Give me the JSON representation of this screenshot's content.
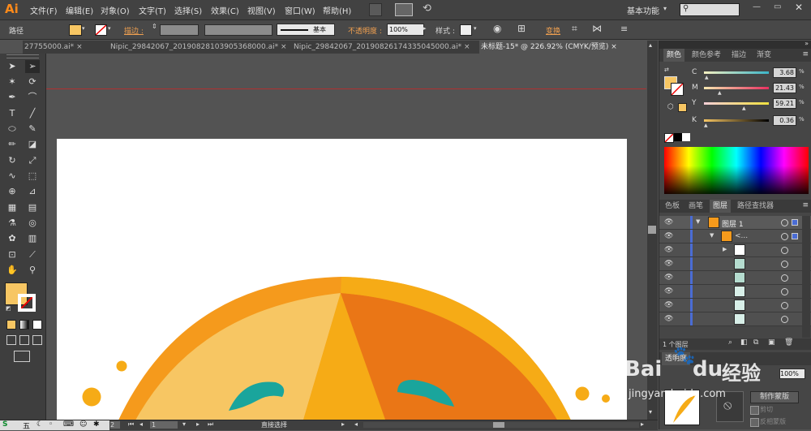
{
  "app": {
    "logo": "Ai",
    "workspace": "基本功能",
    "search_icon": "search-icon"
  },
  "menu": [
    "文件(F)",
    "编辑(E)",
    "对象(O)",
    "文字(T)",
    "选择(S)",
    "效果(C)",
    "视图(V)",
    "窗口(W)",
    "帮助(H)"
  ],
  "control": {
    "selection_label": "路径",
    "stroke_label": "描边 :",
    "stroke_profile": "基本",
    "opacity_label": "不透明度 :",
    "opacity_value": "100%",
    "style_label": "样式 :",
    "transform_label": "变换"
  },
  "tabs": [
    {
      "label": "27755000.ai*",
      "active": false
    },
    {
      "label": "Nipic_29842067_20190828103905368000.ai*",
      "active": false
    },
    {
      "label": "Nipic_29842067_20190826174335045000.ai*",
      "active": false
    },
    {
      "label": "未标题-15* @ 226.92% (CMYK/预览)",
      "active": true
    }
  ],
  "status": {
    "page": "1",
    "zoom_partial": "2",
    "tool": "直接选择"
  },
  "color_panel": {
    "tabs": [
      "颜色",
      "颜色参考",
      "描边",
      "渐变"
    ],
    "channels": [
      {
        "name": "C",
        "value": "3.68"
      },
      {
        "name": "M",
        "value": "21.43"
      },
      {
        "name": "Y",
        "value": "59.21"
      },
      {
        "name": "K",
        "value": "0.36"
      }
    ]
  },
  "layers_panel": {
    "tabs": [
      "色板",
      "画笔",
      "图层",
      "路径查找器"
    ],
    "layer_name": "图层 1",
    "group_name": "<...",
    "footer": "1 个图层"
  },
  "lower_panel": {
    "tab": "透明度",
    "opacity": "100%",
    "make_mask": "制作蒙版",
    "clip": "剪切",
    "invert": "反相蒙版"
  },
  "watermark": {
    "brand": "Bai",
    "du": "du",
    "suffix": "经验",
    "url": "jingyan.baidu.com"
  },
  "colors": {
    "fill": "#f7c663",
    "accent": "#ff8a1a"
  },
  "taskbar_ime": "五"
}
